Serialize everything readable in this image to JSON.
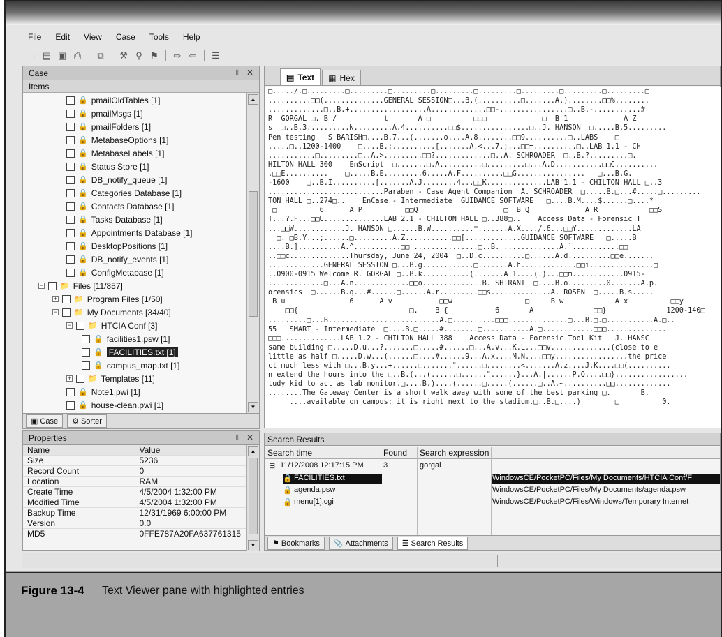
{
  "menu": [
    "File",
    "Edit",
    "View",
    "Case",
    "Tools",
    "Help"
  ],
  "toolbar_icons": [
    "new-icon",
    "open-icon",
    "save-icon",
    "print-icon",
    "copy-icon",
    "find-icon",
    "search-icon",
    "bookmark-icon",
    "next-icon",
    "prev-icon",
    "options-icon"
  ],
  "case_pane": {
    "title": "Case",
    "subheader": "Items",
    "tree": [
      {
        "label": "pmailOldTables [1]",
        "indent": 3
      },
      {
        "label": "pmailMsgs [1]",
        "indent": 3
      },
      {
        "label": "pmailFolders [1]",
        "indent": 3
      },
      {
        "label": "MetabaseOptions [1]",
        "indent": 3
      },
      {
        "label": "MetabaseLabels [1]",
        "indent": 3
      },
      {
        "label": "Status Store [1]",
        "indent": 3
      },
      {
        "label": "DB_notify_queue [1]",
        "indent": 3
      },
      {
        "label": "Categories Database [1]",
        "indent": 3
      },
      {
        "label": "Contacts Database [1]",
        "indent": 3
      },
      {
        "label": "Tasks Database [1]",
        "indent": 3
      },
      {
        "label": "Appointments Database [1]",
        "indent": 3
      },
      {
        "label": "DesktopPositions [1]",
        "indent": 3
      },
      {
        "label": "DB_notify_events [1]",
        "indent": 3
      },
      {
        "label": "ConfigMetabase [1]",
        "indent": 3
      },
      {
        "label": "Files [11/857]",
        "indent": 1,
        "folder": true,
        "expander": "-"
      },
      {
        "label": "Program Files [1/50]",
        "indent": 2,
        "folder": true,
        "expander": "+"
      },
      {
        "label": "My Documents [34/40]",
        "indent": 2,
        "folder": true,
        "expander": "-"
      },
      {
        "label": "HTCIA Conf [3]",
        "indent": 3,
        "folder": true,
        "expander": "-"
      },
      {
        "label": "facilities1.psw [1]",
        "indent": 4
      },
      {
        "label": "FACILITIES.txt [1]",
        "indent": 4,
        "selected": true
      },
      {
        "label": "campus_map.txt [1]",
        "indent": 4
      },
      {
        "label": "Templates [11]",
        "indent": 3,
        "folder": true,
        "expander": "+"
      },
      {
        "label": "Note1.pwi [1]",
        "indent": 3
      },
      {
        "label": "house-clean.pwi [1]",
        "indent": 3
      }
    ],
    "tabs": [
      "Case",
      "Sorter"
    ]
  },
  "properties": {
    "title": "Properties",
    "columns": [
      "Name",
      "Value"
    ],
    "rows": [
      [
        "Size",
        "5236"
      ],
      [
        "Record Count",
        "0"
      ],
      [
        "Location",
        "RAM"
      ],
      [
        "Create Time",
        "4/5/2004 1:32:00 PM"
      ],
      [
        "Modified Time",
        "4/5/2004 1:32:00 PM"
      ],
      [
        "Backup Time",
        "12/31/1969 6:00:00 PM"
      ],
      [
        "Version",
        "0.0"
      ],
      [
        "MD5",
        "0FFE787A20FA637761315"
      ]
    ]
  },
  "viewer": {
    "tabs": [
      "Text",
      "Hex"
    ],
    "lines": [
      "□...../.□.........□.........□.........□.........□.........□.........□.........□.........□",
      "..........□□(..............GENERAL SESSION□...B.(..........□.......A.)........□□%........",
      ".............□..B.+..................A.............□□-................□..B.-...........#",
      "R  GORGAL □. B /           t       A □          □□□             □  B 1             A Z",
      "s  □..B.3..........N.........A.4..........□□$................□..J. HANSON  □.....B.5.........",
      "Pen testing   S BARISH□....B.7...(.......o....A.8........□□9..........□..LABS    □",
      ".....□..1200-1400    □....B.;..........[.......A.<...7.;...□□=..........□..LAB 1.1 - CH",
      "...........□.........□..A.>.........□□?.............□..A. SCHROADER  □..B.?.........□.",
      "HILTON HALL 300    EnScript  □.......□.A..........□.........□...A.D...........□□C..........",
      ".□□E..........    □.....B.E.........6.....A.F..........□□G................   □...B.G.",
      "-1600    □..B.I..........[.......A.J........4...□□K..............LAB 1.1 - CHILTON HALL □..3",
      "...........................Paraben - Case Agent Companion  A. SCHROADER  □.....B.□...#.....□.........",
      "TON HALL □..274□..    EnCase - Intermediate  GUIDANCE SOFTWARE   □....B.M....$......□....*",
      " □          6      A P          □□Q                    □  B Q             A R            □□S",
      "T...?.F...□□U..............LAB 2.1 - CHILTON HALL □..388□..    Access Data - Forensic T",
      "...□□W............J. HANSON □......B.W..........*.......A.X..../.6...□□Y.............LA",
      "  □. □B.Y...;......□.........A.Z...........□□[.............GUIDANCE SOFTWARE   □.....B",
      "....B.]..........A.^...........□□ ...............□..B. .............A.`...........□□",
      "..□□c..............Thursday, June 24, 2004  □..D.c..........□......A.d..........□□e.......",
      ".............GENERAL SESSION □...B.g............□.......A.h.............□□i...............□",
      "..0900-0915 Welcome R. GORGAL □..B.k...........(.......A.1....(.)...□□m............0915-",
      ".............□...A.n.............□□o..............B. SHIRANI  □....B.o.........0.......A.p.",
      "orensics  □......B.q...#......□......A.r.........□□s..............A. ROSEN  □.....B.s.....",
      " B u               6      A v           □□w                 □     B w            A x          □□y",
      "    □□{                          □.    B {           6       A |            □□}              1200-140□",
      ".........□...B..........................A.□..........□□□..............□...B.□.□...........A.□..",
      "55   SMART - Intermediate  □....B.□.....#........□...........A.□............□□□..............",
      "□□□..............LAB 1.2 - CHILTON HALL 388    Access Data - Forensic Tool Kit   J. HANSC",
      "same building □.....D.u...?.......□.....#......□...A.v...K.L...□□v..............(close to e",
      "little as half □.....D.w...(......□....#......9...A.x....M.N....□□y.................the price",
      "ct much less with □...B.y...+......□.......\"......□........<.......A.z....J.K....□□(..........",
      "n extend the hours into the □..B.(...(......□......\"......}...A.|......P.Q....□□}.................",
      "tudy kid to act as lab monitor.□....B.)....(......□.....(......□..A.~..........□□.............",
      "........The Gateway Center is a short walk away with some of the best parking □.       B.",
      "     ....available on campus; it is right next to the stadium.□..B.□....)        □          0."
    ]
  },
  "search_results": {
    "title": "Search Results",
    "columns": [
      "Search time",
      "Found",
      "Search expression"
    ],
    "group": {
      "time": "11/12/2008 12:17:15 PM",
      "found": "3",
      "expr": "gorgal"
    },
    "rows": [
      {
        "name": "FACILITIES.txt",
        "path": "WindowsCE/PocketPC/Files/My Documents/HTCIA Conf/F",
        "selected": true
      },
      {
        "name": "agenda.psw",
        "path": "WindowsCE/PocketPC/Files/My Documents/agenda.psw"
      },
      {
        "name": "menu[1].cgi",
        "path": "WindowsCE/PocketPC/Files/Windows/Temporary Internet"
      }
    ],
    "tabs": [
      "Bookmarks",
      "Attachments",
      "Search Results"
    ]
  },
  "caption": {
    "figure": "Figure 13-4",
    "text": "Text Viewer pane with highlighted entries"
  }
}
